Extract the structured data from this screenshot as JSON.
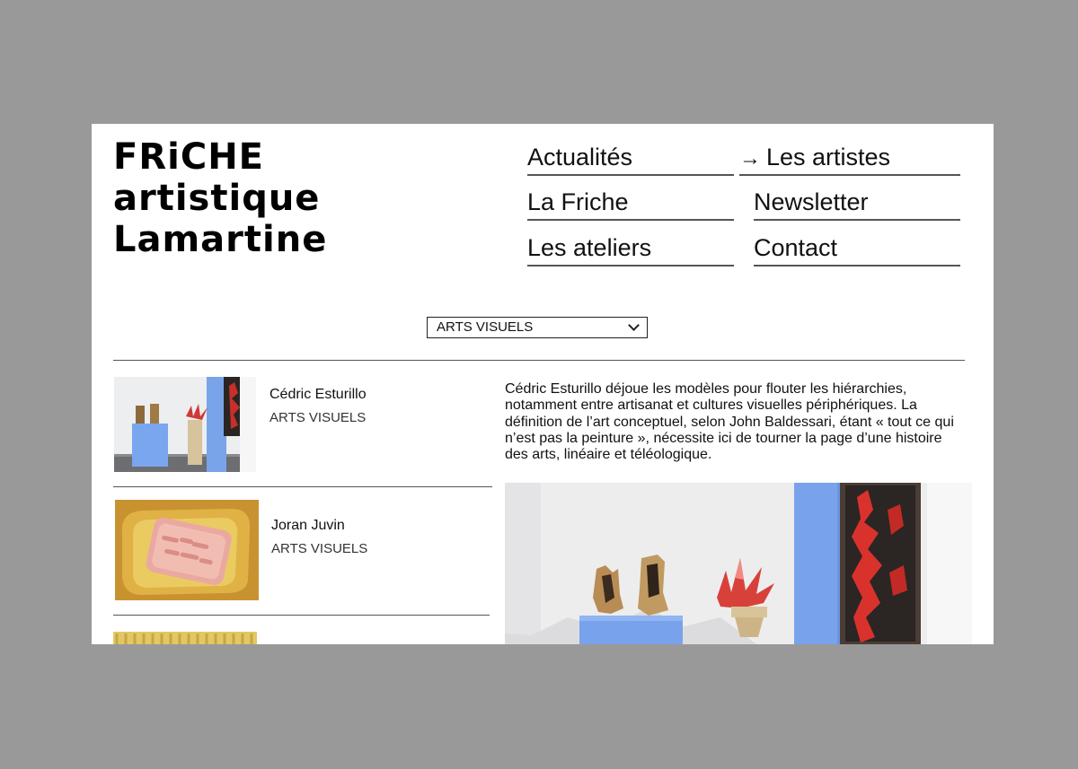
{
  "logo": {
    "line1": "FRiCHE",
    "line2": "artistique",
    "line3": "Lamartine"
  },
  "nav": {
    "items": [
      {
        "label": "Actualités",
        "active": false
      },
      {
        "label": "Les artistes",
        "active": true,
        "arrow": "→"
      },
      {
        "label": "La Friche",
        "active": false
      },
      {
        "label": "Newsletter",
        "active": false
      },
      {
        "label": "Les ateliers",
        "active": false
      },
      {
        "label": "Contact",
        "active": false
      }
    ]
  },
  "filter": {
    "selected": "ARTS VISUELS",
    "icon": "chevron-down-icon"
  },
  "artists": [
    {
      "name": "Cédric Esturillo",
      "category": "ARTS VISUELS"
    },
    {
      "name": "Joran Juvin",
      "category": "ARTS VISUELS"
    }
  ],
  "description": "Cédric Esturillo déjoue les modèles pour flouter les hiérarchies, notamment entre artisanat et cultures visuelles périphériques. La définition de l’art conceptuel, selon John Baldessari, étant « tout ce qui n’est pas la peinture », nécessite ici de tourner la page d’une histoire des arts, linéaire et téléologique.",
  "colors": {
    "page_background": "#999999",
    "frame_background": "#ffffff",
    "pedestal_blue": "#7aa6ef",
    "soap_gold": "#c98f2f",
    "soap_pink": "#e8a9a0"
  }
}
